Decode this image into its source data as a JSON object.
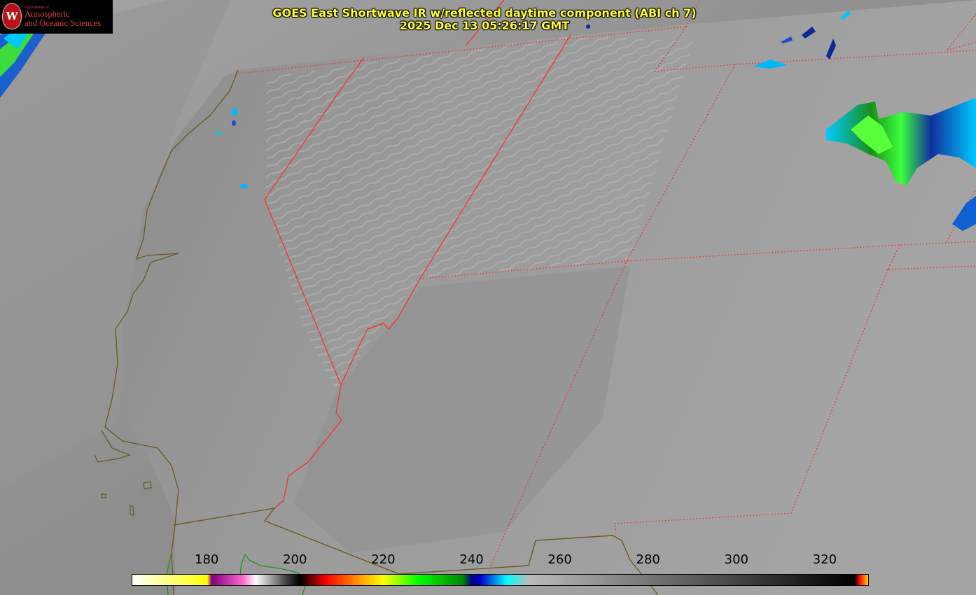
{
  "header": {
    "title": "GOES East Shortwave IR w/reflected daytime component (ABI ch 7)",
    "timestamp": "2025 Dec 13 05:26:17 GMT"
  },
  "logo": {
    "dept": "Department of",
    "name_line1": "Atmospheric",
    "name_line2": "and Oceanic Sciences",
    "seal_letter": "W"
  },
  "colorbar": {
    "min": 163,
    "max": 330,
    "tick_values": [
      180,
      200,
      220,
      240,
      260,
      280,
      300,
      320
    ],
    "tick_labels": [
      "180",
      "200",
      "220",
      "240",
      "260",
      "280",
      "300",
      "320"
    ],
    "stops": [
      {
        "value": 163,
        "color": "#ffffff"
      },
      {
        "value": 180,
        "color": "#ffff00"
      },
      {
        "value": 181,
        "color": "#800080"
      },
      {
        "value": 188,
        "color": "#ff66cc"
      },
      {
        "value": 191,
        "color": "#ffffff"
      },
      {
        "value": 198,
        "color": "#404040"
      },
      {
        "value": 201,
        "color": "#000000"
      },
      {
        "value": 207,
        "color": "#ff0000"
      },
      {
        "value": 217,
        "color": "#ffcc00"
      },
      {
        "value": 220,
        "color": "#ffff00"
      },
      {
        "value": 228,
        "color": "#00ff00"
      },
      {
        "value": 238,
        "color": "#008800"
      },
      {
        "value": 240,
        "color": "#000080"
      },
      {
        "value": 242,
        "color": "#0000cc"
      },
      {
        "value": 248,
        "color": "#00ffff"
      },
      {
        "value": 253,
        "color": "#bbbbbb"
      },
      {
        "value": 327,
        "color": "#000000"
      },
      {
        "value": 328,
        "color": "#ff0000"
      },
      {
        "value": 330,
        "color": "#ffcc00"
      }
    ]
  },
  "map": {
    "state_border_color": "#ff2a2a",
    "coastline_color": "#6b5a1e",
    "national_border_color": "#6b5a1e",
    "lake_outline_color": "#1f8f1f"
  }
}
